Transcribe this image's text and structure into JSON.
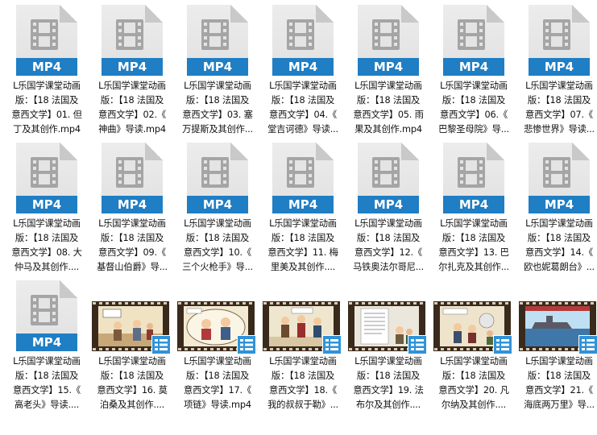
{
  "files": [
    {
      "type": "mp4",
      "badge": "MP4",
      "name": "L乐国学课堂动画\n版：【18 法国及\n意西文学】01. 但\n丁及其创作.mp4"
    },
    {
      "type": "mp4",
      "badge": "MP4",
      "name": "L乐国学课堂动画\n版：【18 法国及\n意西文学】02.《\n神曲》导读.mp4"
    },
    {
      "type": "mp4",
      "badge": "MP4",
      "name": "L乐国学课堂动画\n版：【18 法国及\n意西文学】03. 塞\n万提斯及其创作..."
    },
    {
      "type": "mp4",
      "badge": "MP4",
      "name": "L乐国学课堂动画\n版：【18 法国及\n意西文学】04.《\n堂吉诃德》导读..."
    },
    {
      "type": "mp4",
      "badge": "MP4",
      "name": "L乐国学课堂动画\n版：【18 法国及\n意西文学】05. 雨\n果及其创作.mp4"
    },
    {
      "type": "mp4",
      "badge": "MP4",
      "name": "L乐国学课堂动画\n版：【18 法国及\n意西文学】06.《\n巴黎圣母院》导..."
    },
    {
      "type": "mp4",
      "badge": "MP4",
      "name": "L乐国学课堂动画\n版：【18 法国及\n意西文学】07.《\n悲惨世界》导读..."
    },
    {
      "type": "mp4",
      "badge": "MP4",
      "name": "L乐国学课堂动画\n版：【18 法国及\n意西文学】08. 大\n仲马及其创作...."
    },
    {
      "type": "mp4",
      "badge": "MP4",
      "name": "L乐国学课堂动画\n版：【18 法国及\n意西文学】09.《\n基督山伯爵》导..."
    },
    {
      "type": "mp4",
      "badge": "MP4",
      "name": "L乐国学课堂动画\n版：【18 法国及\n意西文学】10.《\n三个火枪手》导..."
    },
    {
      "type": "mp4",
      "badge": "MP4",
      "name": "L乐国学课堂动画\n版：【18 法国及\n意西文学】11. 梅\n里美及其创作...."
    },
    {
      "type": "mp4",
      "badge": "MP4",
      "name": "L乐国学课堂动画\n版：【18 法国及\n意西文学】12.《\n马铁奥法尔哥尼..."
    },
    {
      "type": "mp4",
      "badge": "MP4",
      "name": "L乐国学课堂动画\n版：【18 法国及\n意西文学】13. 巴\n尔扎克及其创作..."
    },
    {
      "type": "mp4",
      "badge": "MP4",
      "name": "L乐国学课堂动画\n版：【18 法国及\n意西文学】14.《\n欧也妮葛朗台》..."
    },
    {
      "type": "mp4",
      "badge": "MP4",
      "name": "L乐国学课堂动画\n版：【18 法国及\n意西文学】15.《\n高老头》导读...."
    },
    {
      "type": "video",
      "scene": "scene-16",
      "name": "L乐国学课堂动画\n版：【18 法国及\n意西文学】16. 莫\n泊桑及其创作...."
    },
    {
      "type": "video",
      "scene": "scene-17",
      "name": "L乐国学课堂动画\n版：【18 法国及\n意西文学】17.《\n项链》导读.mp4"
    },
    {
      "type": "video",
      "scene": "scene-18",
      "name": "L乐国学课堂动画\n版：【18 法国及\n意西文学】18.《\n我的叔叔于勒》..."
    },
    {
      "type": "video",
      "scene": "scene-19",
      "name": "L乐国学课堂动画\n版：【18 法国及\n意西文学】19. 法\n布尔及其创作...."
    },
    {
      "type": "video",
      "scene": "scene-20",
      "name": "L乐国学课堂动画\n版：【18 法国及\n意西文学】20. 凡\n尔纳及其创作...."
    },
    {
      "type": "video",
      "scene": "scene-21",
      "name": "L乐国学课堂动画\n版：【18 法国及\n意西文学】21.《\n海底两万里》导..."
    }
  ],
  "colors": {
    "mp4_band": "#1f7ec4",
    "doc_body": "#e6e6e6",
    "video_badge": "#2f93d9"
  }
}
